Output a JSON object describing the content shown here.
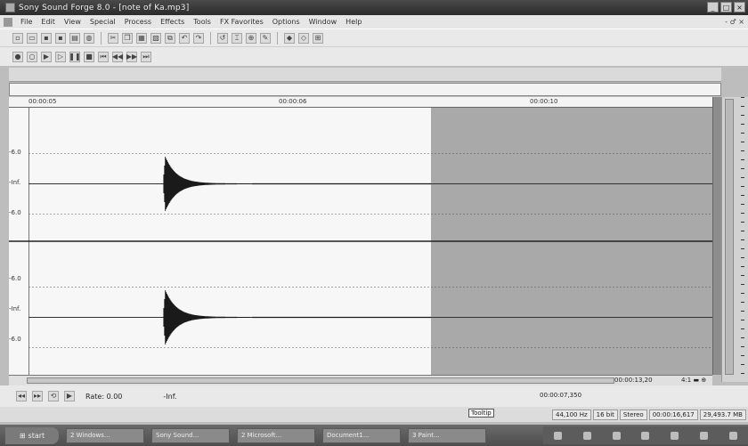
{
  "window": {
    "title": "Sony Sound Forge 8.0 - [note of Ka.mp3]",
    "minimize": "_",
    "maximize": "□",
    "close": "×"
  },
  "menu": {
    "items": [
      "File",
      "Edit",
      "View",
      "Special",
      "Process",
      "Effects",
      "Tools",
      "FX Favorites",
      "Options",
      "Window",
      "Help"
    ],
    "mdi_controls": "- ♂ ×"
  },
  "ruler": {
    "labels": [
      "00:00:05",
      "00:00:06",
      "00:00:10"
    ]
  },
  "wave": {
    "db_labels_top": [
      "-6.0",
      "-Inf.",
      "-6.0"
    ],
    "db_labels_bottom": [
      "-6.0",
      "-Inf.",
      "-6.0"
    ],
    "channels": 2,
    "selection_start_fraction": 0.6
  },
  "hscroll": {
    "selection_time": "00:00:13,20",
    "zoom": "4:1 ▬ ⊕"
  },
  "transport": {
    "rate_label": "Rate: 0.00",
    "level_label": "-Inf.",
    "cursor_position": "00:00:07,350"
  },
  "status": {
    "tooltip": "Tooltip",
    "sample_rate": "44,100 Hz",
    "bit_depth": "16 bit",
    "channels": "Stereo",
    "length": "00:00:16,617",
    "disk_space": "29,493.7 MB"
  },
  "taskbar": {
    "start_label": "start",
    "tasks": [
      "2 Windows...",
      "Sony Sound...",
      "2 Microsoft...",
      "Document1...",
      "3 Paint..."
    ]
  }
}
